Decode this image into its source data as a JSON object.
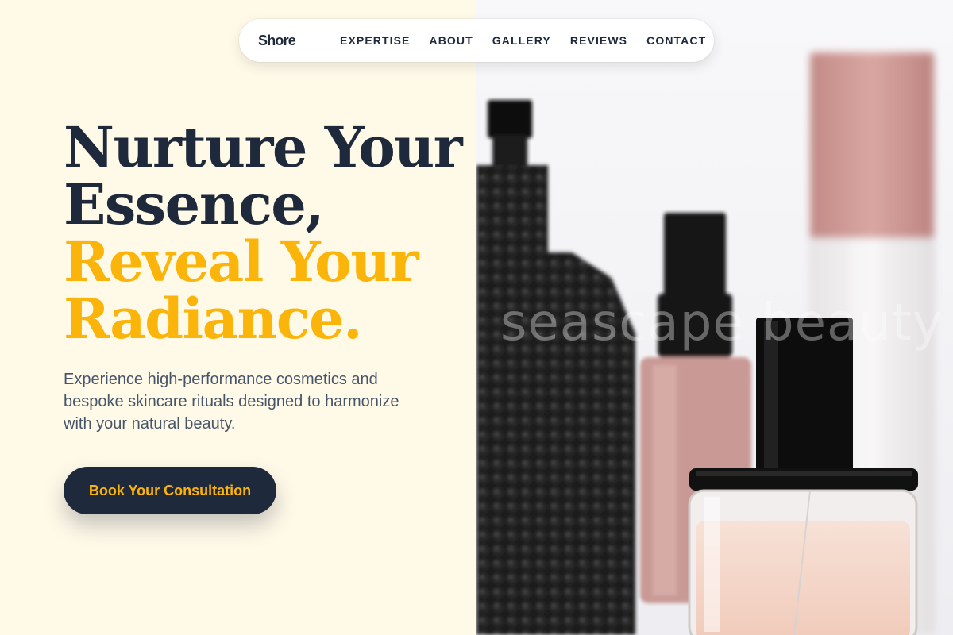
{
  "nav": {
    "brand": "Shore",
    "links": [
      {
        "label": "EXPERTISE"
      },
      {
        "label": "ABOUT"
      },
      {
        "label": "GALLERY"
      },
      {
        "label": "REVIEWS"
      },
      {
        "label": "CONTACT"
      }
    ]
  },
  "hero": {
    "line1": "Nurture Your",
    "line2": "Essence,",
    "line3": "Reveal Your",
    "line4": "Radiance.",
    "subtitle": "Experience high-performance cosmetics and bespoke skincare rituals designed to harmonize with your natural beauty.",
    "cta_label": "Book Your Consultation"
  },
  "image": {
    "watermark": "seascape beauty",
    "subject": "perfume-bottles"
  },
  "colors": {
    "navy": "#1e293b",
    "gold": "#fbb40a",
    "cream": "#fff9e8",
    "slate": "#475569"
  }
}
